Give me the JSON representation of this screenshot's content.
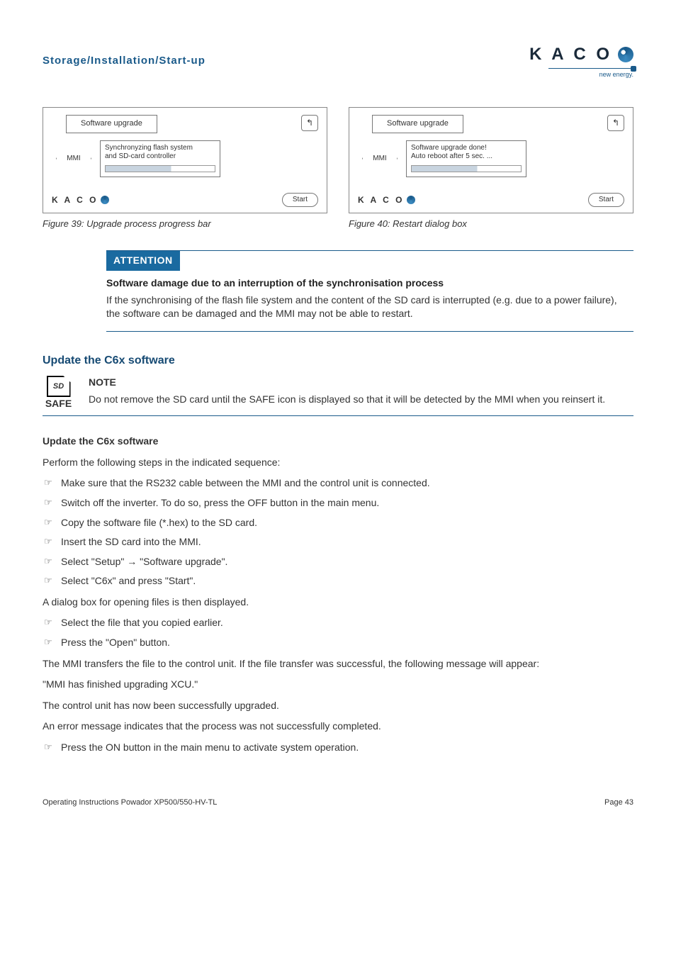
{
  "header": {
    "breadcrumb": "Storage/Installation/Start-up",
    "logo_text": "K A C O",
    "logo_sub": "new energy."
  },
  "figures": {
    "left": {
      "title": "Software upgrade",
      "back": "↰",
      "node": "MMI",
      "msg_l1": "Synchronyzing flash system",
      "msg_l2": "and SD-card controller",
      "footer_logo": "K A C O",
      "start": "Start",
      "caption": "Figure 39:  Upgrade process progress bar"
    },
    "right": {
      "title": "Software upgrade",
      "back": "↰",
      "node": "MMI",
      "msg_l1": "Software upgrade done!",
      "msg_l2": "Auto reboot after 5 sec. ...",
      "footer_logo": "K A C O",
      "start": "Start",
      "caption": "Figure 40:  Restart dialog box"
    }
  },
  "attention": {
    "header": "ATTENTION",
    "bold": "Software damage due to an interruption of the synchronisation process",
    "body": "If the synchronising of the flash file system and the content of the SD card is interrupted (e.g. due to a power failure), the software can be damaged and the MMI may not be able to restart."
  },
  "section": {
    "title": "Update the C6x software",
    "note_label": "NOTE",
    "note_body": "Do not remove the SD card until the SAFE icon is displayed so that it will be detected by the MMI when you reinsert it.",
    "sd_text": "SD",
    "safe_text": "SAFE"
  },
  "procedure": {
    "sub_title": "Update the C6x software",
    "intro": "Perform the following steps in the indicated sequence:",
    "steps_a": [
      "Make sure that the RS232 cable between the MMI and the control unit is connected.",
      "Switch off the inverter. To do so, press the OFF button in the main menu.",
      "Copy the software file (*.hex) to the SD card.",
      "Insert the SD card into the MMI.",
      "Select \"Setup\" → \"Software upgrade\".",
      "Select \"C6x\" and press \"Start\"."
    ],
    "mid1": "A dialog box for opening files is then displayed.",
    "steps_b": [
      "Select the file that you copied earlier.",
      "Press the \"Open\" button."
    ],
    "mid2": "The MMI transfers the file to the control unit. If the file transfer was successful, the following message will appear:",
    "quote": "\"MMI has finished upgrading XCU.\"",
    "mid3": "The control unit has now been successfully upgraded.",
    "mid4": "An error message indicates that the process was not successfully completed.",
    "steps_c": [
      "Press the ON button in the main menu to activate system operation."
    ]
  },
  "footer": {
    "left": "Operating Instructions Powador XP500/550-HV-TL",
    "right": "Page 43"
  }
}
